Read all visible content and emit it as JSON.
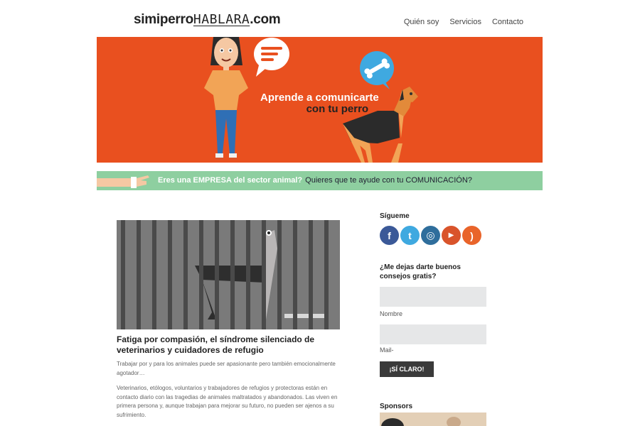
{
  "header": {
    "logo_a": "simiperro",
    "logo_b": "HABLARA",
    "logo_c": ".com",
    "nav": [
      "Quién soy",
      "Servicios",
      "Contacto"
    ]
  },
  "hero": {
    "line1": "Aprende a comunicarte",
    "line2": "con tu perro"
  },
  "banner": {
    "part1": "Eres una EMPRESA del sector animal?",
    "part2": "Quieres que te ayude con tu COMUNICACIÓN?"
  },
  "post": {
    "title": "Fatiga por compasión, el síndrome silenciado de veterinarios y cuidadores de refugio",
    "excerpt": "Trabajar por y para los animales puede ser apasionante pero también emocionalmente agotador…",
    "body": "Veterinarios, etólogos, voluntarios y trabajadores de refugios y protectoras están en contacto diario con las tragedias de animales maltratados y abandonados. Las viven en primera persona y, aunque trabajan para mejorar su futuro, no pueden ser ajenos a su sufrimiento."
  },
  "sidebar": {
    "follow_title": "Sígueme",
    "social": [
      {
        "name": "facebook",
        "glyph": "f",
        "color": "#3b5998"
      },
      {
        "name": "twitter",
        "glyph": "t",
        "color": "#3fa9e0"
      },
      {
        "name": "instagram",
        "glyph": "◎",
        "color": "#2f6e9c"
      },
      {
        "name": "youtube",
        "glyph": "▶",
        "color": "#d9542b"
      },
      {
        "name": "rss",
        "glyph": ")",
        "color": "#e9642a"
      }
    ],
    "newsletter_title": "¿Me dejas darte buenos consejos gratis?",
    "name_label": "Nombre",
    "mail_label": "Mail-",
    "submit_label": "¡SÍ CLARO!",
    "sponsors_title": "Sponsors"
  },
  "colors": {
    "hero_bg": "#e9501f",
    "banner_bg": "#8ecfa0",
    "button_bg": "#3a3a3a"
  }
}
